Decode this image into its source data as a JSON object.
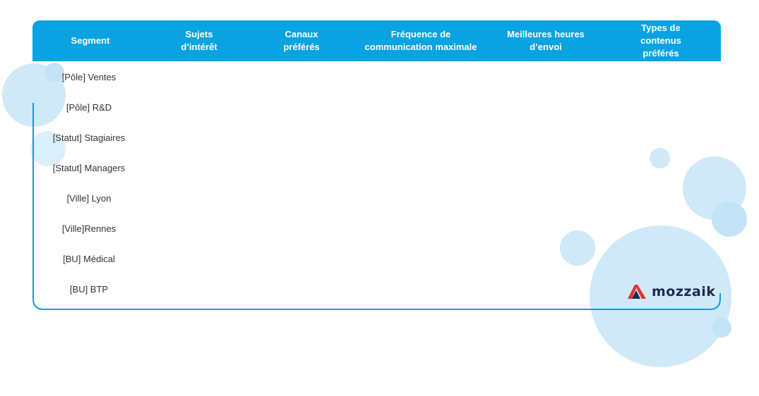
{
  "header": {
    "columns": [
      "Segment",
      "Sujets\nd’intérêt",
      "Canaux\npréférés",
      "Fréquence de\ncommunication maximale",
      "Meilleures heures\nd’envoi",
      "Types de contenus\npréférés"
    ]
  },
  "segments": [
    "[Pôle] Ventes",
    "[Pôle] R&D",
    "[Statut] Stagiaires",
    "[Statut] Managers",
    "[Ville] Lyon",
    "[Ville]Rennes",
    "[BU] Médical",
    "[BU] BTP"
  ],
  "logo": {
    "text": "mozzaik"
  },
  "colors": {
    "header_bg": "#0aa3e2",
    "border": "#0a9fdc",
    "bubble": "#cfe9f9",
    "logo_red": "#e5322d",
    "logo_navy": "#1d2a4d"
  }
}
